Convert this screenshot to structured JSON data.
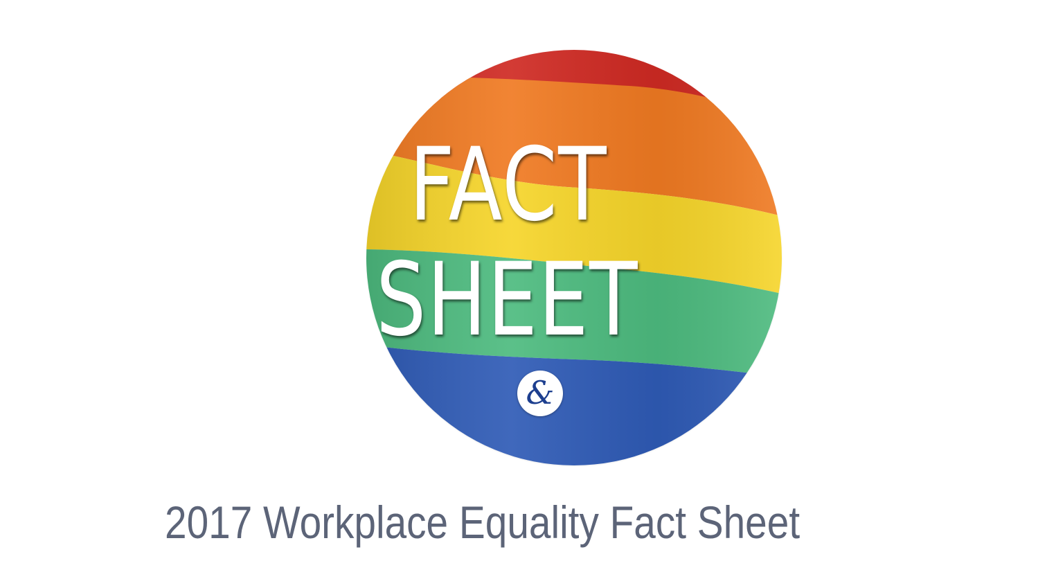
{
  "badge": {
    "line_1": "FACT",
    "line_2": "SHEET",
    "logo_symbol": "&",
    "stripe_colors": [
      "#cf2a23",
      "#f07a22",
      "#f6d52a",
      "#4dbb7f",
      "#2f5bb6"
    ]
  },
  "caption": {
    "title": "2017 Workplace Equality Fact Sheet"
  }
}
